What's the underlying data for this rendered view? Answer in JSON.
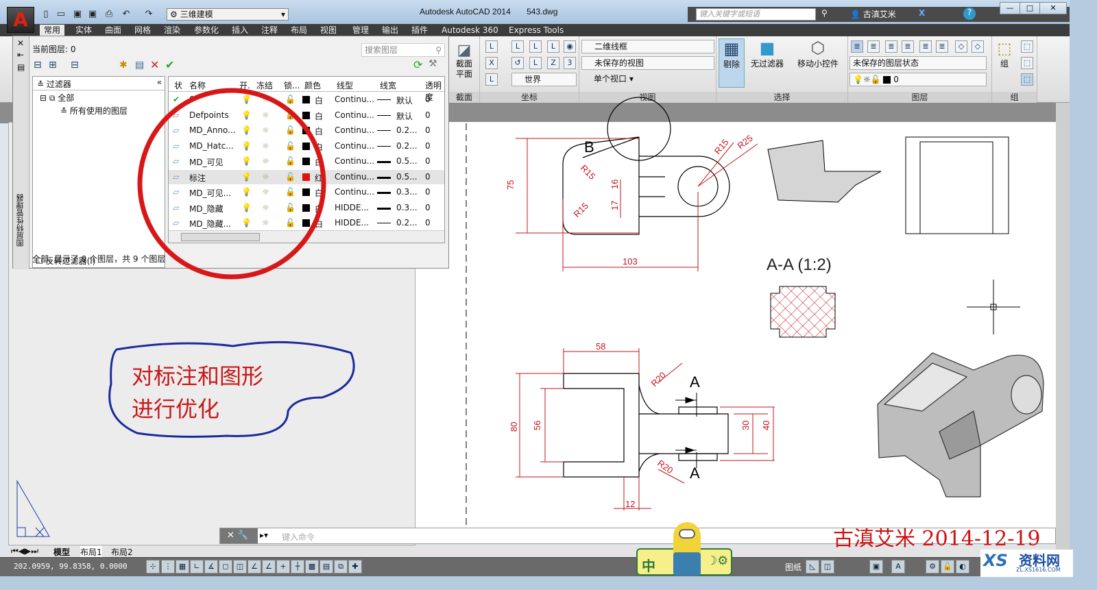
{
  "titlebar": {
    "app_title": "Autodesk AutoCAD 2014",
    "file_name": "543.dwg",
    "workspace": "三维建模",
    "search_placeholder": "键入关键字或短语",
    "user": "古滇艾米",
    "app_logo": "A"
  },
  "ribbon_tabs": [
    "常用",
    "实体",
    "曲面",
    "网格",
    "渲染",
    "参数化",
    "插入",
    "注释",
    "布局",
    "视图",
    "管理",
    "输出",
    "插件",
    "Autodesk 360",
    "Express Tools"
  ],
  "ribbon": {
    "section_plane": "截面\n平面",
    "section_title": "截面",
    "coord_title": "坐标",
    "coord_world": "世界",
    "view_title": "视图",
    "visual_style": "二维线框",
    "named_view": "未保存的视图",
    "viewport": "单个视口",
    "select_title": "选择",
    "cull": "剔除",
    "no_filter": "无过滤器",
    "gizmo": "移动小控件",
    "layers_title": "图层",
    "layer_state": "未保存的图层状态",
    "layer_current": "0",
    "group_title": "组",
    "group": "组"
  },
  "layer_panel": {
    "side_title": "图层特性管理器",
    "current_layer": "当前图层: 0",
    "search_placeholder": "搜索图层",
    "filter_header": "过滤器",
    "filter_all": "全部",
    "filter_used": "所有使用的图层",
    "invert_filter": "反转过滤器(I)",
    "status": "全部: 显示了 9 个图层，共 9 个图层",
    "columns": [
      "状",
      "名称",
      "开.",
      "冻结",
      "锁...",
      "颜色",
      "线型",
      "线宽",
      "透明度"
    ],
    "rows": [
      {
        "name": "0",
        "color_name": "白",
        "color": "#000000",
        "linetype": "Continu...",
        "lineweight": "默认",
        "transparency": "0",
        "current": true
      },
      {
        "name": "Defpoints",
        "color_name": "白",
        "color": "#000000",
        "linetype": "Continu...",
        "lineweight": "默认",
        "transparency": "0"
      },
      {
        "name": "MD_Anno...",
        "color_name": "白",
        "color": "#000000",
        "linetype": "Continu...",
        "lineweight": "0.2...",
        "transparency": "0"
      },
      {
        "name": "MD_Hatc...",
        "color_name": "白",
        "color": "#000000",
        "linetype": "Continu...",
        "lineweight": "0.2...",
        "transparency": "0"
      },
      {
        "name": "MD_可见",
        "color_name": "白",
        "color": "#000000",
        "linetype": "Continu...",
        "lineweight": "0.5...",
        "transparency": "0"
      },
      {
        "name": "标注",
        "color_name": "红",
        "color": "#e01010",
        "linetype": "Continu...",
        "lineweight": "0.5...",
        "transparency": "0",
        "selected": true
      },
      {
        "name": "MD_可见...",
        "color_name": "白",
        "color": "#000000",
        "linetype": "Continu...",
        "lineweight": "0.3...",
        "transparency": "0"
      },
      {
        "name": "MD_隐藏",
        "color_name": "白",
        "color": "#000000",
        "linetype": "HIDDE...",
        "lineweight": "0.3...",
        "transparency": "0"
      },
      {
        "name": "MD_隐藏...",
        "color_name": "白",
        "color": "#000000",
        "linetype": "HIDDE...",
        "lineweight": "0.2...",
        "transparency": "0"
      }
    ]
  },
  "annotation": {
    "line1": "对标注和图形",
    "line2": "进行优化",
    "circle_color": "#d81818",
    "cloud_color": "#1a2a9a"
  },
  "drawing": {
    "label_b": "B",
    "section_label": "A-A (1:2)",
    "cut_a": "A",
    "dims_top": [
      "75",
      "R15",
      "R15",
      "16",
      "17",
      "R15",
      "R25",
      "103"
    ],
    "dims_bottom": [
      "58",
      "80",
      "56",
      "R20",
      "R20",
      "30",
      "40",
      "12"
    ],
    "dim_color": "#c4161c"
  },
  "signature": "古滇艾米 2014-12-19",
  "watermark": {
    "brand": "资料网",
    "url": "ZL.XS1616.COM"
  },
  "ime": {
    "label": "中"
  },
  "command": {
    "placeholder": "键入命令"
  },
  "layout_tabs": [
    "模型",
    "布局1",
    "布局2"
  ],
  "status": {
    "coords": "202.0959, 99.8358, 0.0000",
    "paper": "图纸"
  }
}
